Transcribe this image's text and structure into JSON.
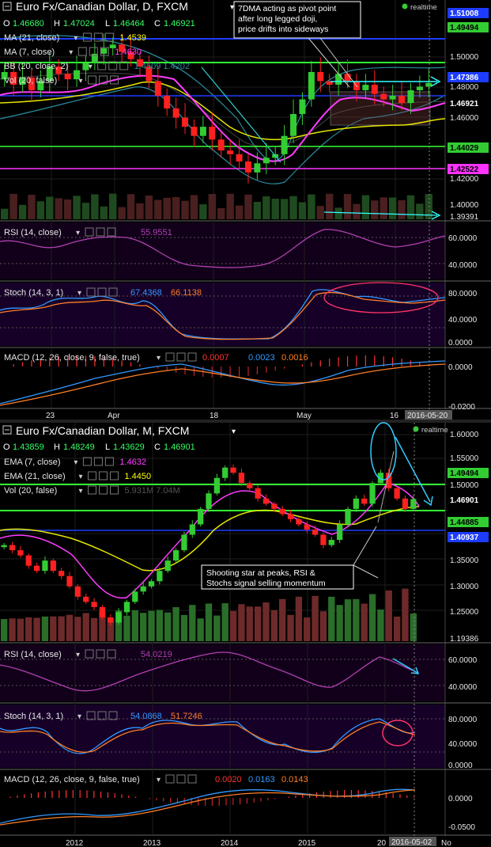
{
  "top": {
    "title": "Euro Fx/Canadian Dollar, D, FXCM",
    "ohlc": {
      "o_label": "O",
      "o": "1.46680",
      "h_label": "H",
      "h": "1.47024",
      "l_label": "L",
      "l": "1.46464",
      "c_label": "C",
      "c": "1.46921"
    },
    "realtime": "realtime",
    "indicators": [
      {
        "label": "MA (21, close)",
        "value": "1.4539",
        "color": "#ffff00"
      },
      {
        "label": "MA (7, close)",
        "value": "1.4630",
        "color": "#ff3cff"
      },
      {
        "label": "BB (20, close, 2)",
        "value": "1.4509  1.4202",
        "color": "#2a8ca0"
      },
      {
        "label": "Vol (20, false)",
        "value": "",
        "color": "#ffffff"
      }
    ],
    "annotation": [
      "7DMA  acting as pivot point",
      "after long legged doji,",
      "price drifts into sideways"
    ],
    "price_labels": [
      {
        "text": "1.51008",
        "bg": "#1d3cff",
        "fg": "#ffffff"
      },
      {
        "text": "1.49494",
        "bg": "#33cc33",
        "fg": "#000000"
      },
      {
        "text": "1.50000",
        "bg": "",
        "fg": "#e6e6e6"
      },
      {
        "text": "1.48000",
        "bg": "",
        "fg": "#e6e6e6"
      },
      {
        "text": "1.47386",
        "bg": "#1d3cff",
        "fg": "#ffffff"
      },
      {
        "text": "1.46921",
        "bg": "#000000",
        "fg": "#ffffff"
      },
      {
        "text": "1.46000",
        "bg": "",
        "fg": "#e6e6e6"
      },
      {
        "text": "1.44029",
        "bg": "#33cc33",
        "fg": "#000000"
      },
      {
        "text": "1.42522",
        "bg": "#ff33ff",
        "fg": "#000000"
      },
      {
        "text": "1.42000",
        "bg": "",
        "fg": "#e6e6e6"
      },
      {
        "text": "1.40000",
        "bg": "",
        "fg": "#e6e6e6"
      },
      {
        "text": "1.39391",
        "bg": "",
        "fg": "#e6e6e6"
      }
    ],
    "rsi": {
      "label": "RSI (14, close)",
      "value": "55.9551",
      "ticks": [
        "60.0000",
        "40.0000"
      ]
    },
    "stoch": {
      "label": "Stoch (14, 3, 1)",
      "k": "67.4368",
      "d": "66.1138",
      "ticks": [
        "80.0000",
        "40.0000",
        "0.0000"
      ]
    },
    "macd": {
      "label": "MACD (12, 26, close, 9, false, true)",
      "v1": "0.0007",
      "v2": "0.0023",
      "v3": "0.0016",
      "ticks": [
        "0.0000",
        "-0.0200"
      ]
    },
    "x_axis": [
      "23",
      "Apr",
      "18",
      "May",
      "16"
    ],
    "date_badge": "2016-05-20"
  },
  "bottom": {
    "title": "Euro Fx/Canadian Dollar, M, FXCM",
    "ohlc": {
      "o_label": "O",
      "o": "1.43859",
      "h_label": "H",
      "h": "1.48249",
      "l_label": "L",
      "l": "1.43629",
      "c_label": "C",
      "c": "1.46901"
    },
    "realtime": "realtime",
    "indicators": [
      {
        "label": "EMA (7, close)",
        "value": "1.4632",
        "color": "#ff3cff"
      },
      {
        "label": "EMA (21, close)",
        "value": "1.4450",
        "color": "#ffff00"
      },
      {
        "label": "Vol (20, false)",
        "value": "5.931M  7.04M",
        "color": "#555555"
      }
    ],
    "annotation": [
      "Shooting star at peaks, RSI &",
      "Stochs signal selling momentum"
    ],
    "price_labels": [
      {
        "text": "1.60000",
        "bg": "",
        "fg": "#e6e6e6"
      },
      {
        "text": "1.55000",
        "bg": "",
        "fg": "#e6e6e6"
      },
      {
        "text": "1.49494",
        "bg": "#33cc33",
        "fg": "#000000"
      },
      {
        "text": "1.50000",
        "bg": "",
        "fg": "#e6e6e6"
      },
      {
        "text": "1.46901",
        "bg": "#000000",
        "fg": "#ffffff"
      },
      {
        "text": "1.44885",
        "bg": "#33cc33",
        "fg": "#000000"
      },
      {
        "text": "1.40937",
        "bg": "#1d3cff",
        "fg": "#ffffff"
      },
      {
        "text": "1.35000",
        "bg": "",
        "fg": "#e6e6e6"
      },
      {
        "text": "1.30000",
        "bg": "",
        "fg": "#e6e6e6"
      },
      {
        "text": "1.25000",
        "bg": "",
        "fg": "#e6e6e6"
      },
      {
        "text": "1.19386",
        "bg": "",
        "fg": "#e6e6e6"
      }
    ],
    "rsi": {
      "label": "RSI (14, close)",
      "value": "54.0219",
      "ticks": [
        "60.0000",
        "40.0000"
      ]
    },
    "stoch": {
      "label": "Stoch (14, 3, 1)",
      "k": "54.0868",
      "d": "51.7246",
      "ticks": [
        "80.0000",
        "40.0000",
        "0.0000"
      ]
    },
    "macd": {
      "label": "MACD (12, 26, close, 9, false, true)",
      "v1": "0.0020",
      "v2": "0.0163",
      "v3": "0.0143",
      "ticks": [
        "0.0000",
        "-0.0500"
      ]
    },
    "x_axis": [
      "2012",
      "2013",
      "2014",
      "2015",
      "20"
    ],
    "date_badge": "2016-05-02",
    "x_axis_end": "No"
  },
  "chart_data": [
    {
      "type": "candlestick",
      "title": "Euro Fx/Canadian Dollar, D, FXCM",
      "timeframe": "D",
      "ylim": [
        1.3939,
        1.5101
      ],
      "close_series": [
        1.475,
        1.468,
        1.472,
        1.465,
        1.47,
        1.478,
        1.474,
        1.471,
        1.476,
        1.48,
        1.485,
        1.488,
        1.49,
        1.486,
        1.482,
        1.478,
        1.47,
        1.462,
        1.455,
        1.45,
        1.445,
        1.44,
        1.445,
        1.438,
        1.432,
        1.43,
        1.426,
        1.42,
        1.425,
        1.428,
        1.43,
        1.44,
        1.452,
        1.46,
        1.475,
        1.47,
        1.468,
        1.474,
        1.47,
        1.465,
        1.468,
        1.463,
        1.46,
        1.462,
        1.458,
        1.465,
        1.467,
        1.469
      ],
      "reference_lines": [
        1.51008,
        1.49494,
        1.47386,
        1.44029,
        1.42522
      ]
    },
    {
      "type": "candlestick",
      "title": "Euro Fx/Canadian Dollar, M, FXCM",
      "timeframe": "M",
      "ylim": [
        1.1939,
        1.6
      ],
      "close_series": [
        1.38,
        1.37,
        1.36,
        1.34,
        1.33,
        1.35,
        1.33,
        1.32,
        1.3,
        1.28,
        1.27,
        1.26,
        1.24,
        1.23,
        1.25,
        1.27,
        1.29,
        1.3,
        1.31,
        1.33,
        1.35,
        1.37,
        1.4,
        1.42,
        1.45,
        1.48,
        1.51,
        1.53,
        1.52,
        1.5,
        1.49,
        1.47,
        1.46,
        1.45,
        1.44,
        1.43,
        1.42,
        1.41,
        1.4,
        1.38,
        1.39,
        1.42,
        1.45,
        1.47,
        1.46,
        1.5,
        1.52,
        1.49,
        1.47,
        1.45,
        1.469
      ],
      "reference_lines": [
        1.49494,
        1.44885,
        1.40937
      ]
    }
  ]
}
